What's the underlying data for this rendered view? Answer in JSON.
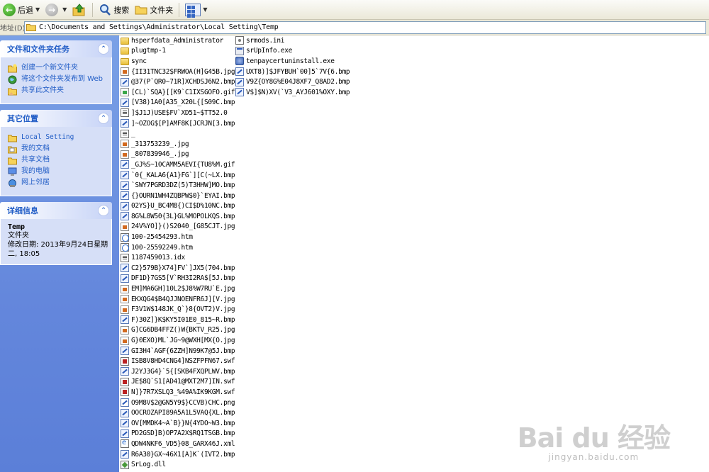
{
  "toolbar": {
    "back_label": "后退",
    "search_label": "搜索",
    "folders_label": "文件夹"
  },
  "address": {
    "label": "地址(D)",
    "path": "C:\\Documents and Settings\\Administrator\\Local Setting\\Temp"
  },
  "left_pane": {
    "file_tasks": {
      "title": "文件和文件夹任务",
      "items": [
        "创建一个新文件夹",
        "将这个文件夹发布到 Web",
        "共享此文件夹"
      ]
    },
    "other_places": {
      "title": "其它位置",
      "items": [
        "Local Setting",
        "我的文档",
        "共享文档",
        "我的电脑",
        "网上邻居"
      ]
    },
    "details": {
      "title": "详细信息",
      "name": "Temp",
      "type": "文件夹",
      "modified": "修改日期: 2013年9月24日星期二, 18:05"
    }
  },
  "files_col1": [
    {
      "name": "hsperfdata_Administrator",
      "icon": "folder"
    },
    {
      "name": "plugtmp-1",
      "icon": "folder"
    },
    {
      "name": "sync",
      "icon": "folder"
    },
    {
      "name": "{II31TNC32$FRWOA(H]G45B.jpg",
      "icon": "jpg"
    },
    {
      "name": "@37(P`QR0~71R]XCHDSJ6N2.bmp",
      "icon": "bmp"
    },
    {
      "name": "[CL)`SQA}[[K9`C1IXSGOFO.gif",
      "icon": "gif"
    },
    {
      "name": "[V38)1A0[A35_X20L{[S09C.bmp",
      "icon": "bmp"
    },
    {
      "name": "]$J1J)USE$FV`XD51~$TT52.0",
      "icon": "doc"
    },
    {
      "name": "]~OZOG$[P]AMF8K[JCRJN[3.bmp",
      "icon": "bmp"
    },
    {
      "name": "_",
      "icon": "doc"
    },
    {
      "name": "_313753239_.jpg",
      "icon": "jpg"
    },
    {
      "name": "_807839946_.jpg",
      "icon": "jpg"
    },
    {
      "name": "_GJ%S~10CAMM5AEVI{TU8%M.gif",
      "icon": "bmp"
    },
    {
      "name": "`0{_KALA6{A1}FG`][C(~LX.bmp",
      "icon": "bmp"
    },
    {
      "name": "`SWY7PGRD3DZ(5)T3HHW]MO.bmp",
      "icon": "bmp"
    },
    {
      "name": "{}OURN1WH4ZQBPW$0}`EYAI.bmp",
      "icon": "bmp"
    },
    {
      "name": "02YS}U_BC4M8{)CI$D%10NC.bmp",
      "icon": "bmp"
    },
    {
      "name": "8G%L8W50{3L}GL%MOPOLKQS.bmp",
      "icon": "bmp"
    },
    {
      "name": "24V%YO]}()S2040_[G85CJT.jpg",
      "icon": "jpg"
    },
    {
      "name": "100-25454293.htm",
      "icon": "htm"
    },
    {
      "name": "100-25592249.htm",
      "icon": "htm"
    },
    {
      "name": "1187459013.idx",
      "icon": "doc"
    },
    {
      "name": "C2}579B}X74]FV`]JX5(704.bmp",
      "icon": "bmp"
    },
    {
      "name": "DF1D}7GS5[V`RH3I2RA$[5J.bmp",
      "icon": "bmp"
    },
    {
      "name": "EM]MA6GH]10L2$J8%W7RU`E.jpg",
      "icon": "jpg"
    },
    {
      "name": "EKXQG4$B4QJJNOENFR6J][V.jpg",
      "icon": "jpg"
    },
    {
      "name": "F3V1W$148JK_Q`}8{OVT2)V.jpg",
      "icon": "jpg"
    },
    {
      "name": "F)30Z]}K$KY5I01E0_815~R.bmp",
      "icon": "bmp"
    },
    {
      "name": "G]CG6DB4FFZ()W{BKTV_R25.jpg",
      "icon": "jpg"
    },
    {
      "name": "G}0EXO)ML`JG~9@WXH[MX{O.jpg",
      "icon": "jpg"
    },
    {
      "name": "GI3H4`AGF{6ZZH]N99K7@5J.bmp",
      "icon": "bmp"
    },
    {
      "name": "ISB8V8HD4CNG4]NSZFPFN67.swf",
      "icon": "swf"
    },
    {
      "name": "J2YJ3G4}`5{[SKB4FXQPLWV.bmp",
      "icon": "bmp"
    },
    {
      "name": "JE$8Q`S1[AD41@MXT2M7]IN.swf",
      "icon": "swf"
    },
    {
      "name": "N]}7R7XSLQ3_%49A%IK9KGM.swf",
      "icon": "swf"
    },
    {
      "name": "O9M8V$2@GN5Y9$}CCVB)CHC.png",
      "icon": "png"
    },
    {
      "name": "OOCROZAPI89A5A1L5VAQ{XL.bmp",
      "icon": "bmp"
    },
    {
      "name": "OV[MMDK4~A`B}}N{4YDO~W3.bmp",
      "icon": "bmp"
    },
    {
      "name": "PD2GSD]B)OP7A2X$RQ1TSGB.bmp",
      "icon": "bmp"
    },
    {
      "name": "QDW4NKF6_VD5}08_GARX46J.xml",
      "icon": "xml"
    },
    {
      "name": "R6A30}GX~46X1[A]K`(IVT2.bmp",
      "icon": "bmp"
    },
    {
      "name": "SrLog.dll",
      "icon": "dll"
    }
  ],
  "files_col2": [
    {
      "name": "srmods.ini",
      "icon": "ini"
    },
    {
      "name": "srUpInfo.exe",
      "icon": "exe"
    },
    {
      "name": "tenpaycertuninstall.exe",
      "icon": "inst"
    },
    {
      "name": "UXT8)]$JFYBUH`00]5`7V{6.bmp",
      "icon": "bmp"
    },
    {
      "name": "V9Z{OY8G%E04J8XF7_Q8AD2.bmp",
      "icon": "bmp"
    },
    {
      "name": "V$]$N)XV(`V3_AYJ601%OXY.bmp",
      "icon": "bmp"
    }
  ],
  "watermark": {
    "logo": "Bai du 经验",
    "url": "jingyan.baidu.com"
  }
}
